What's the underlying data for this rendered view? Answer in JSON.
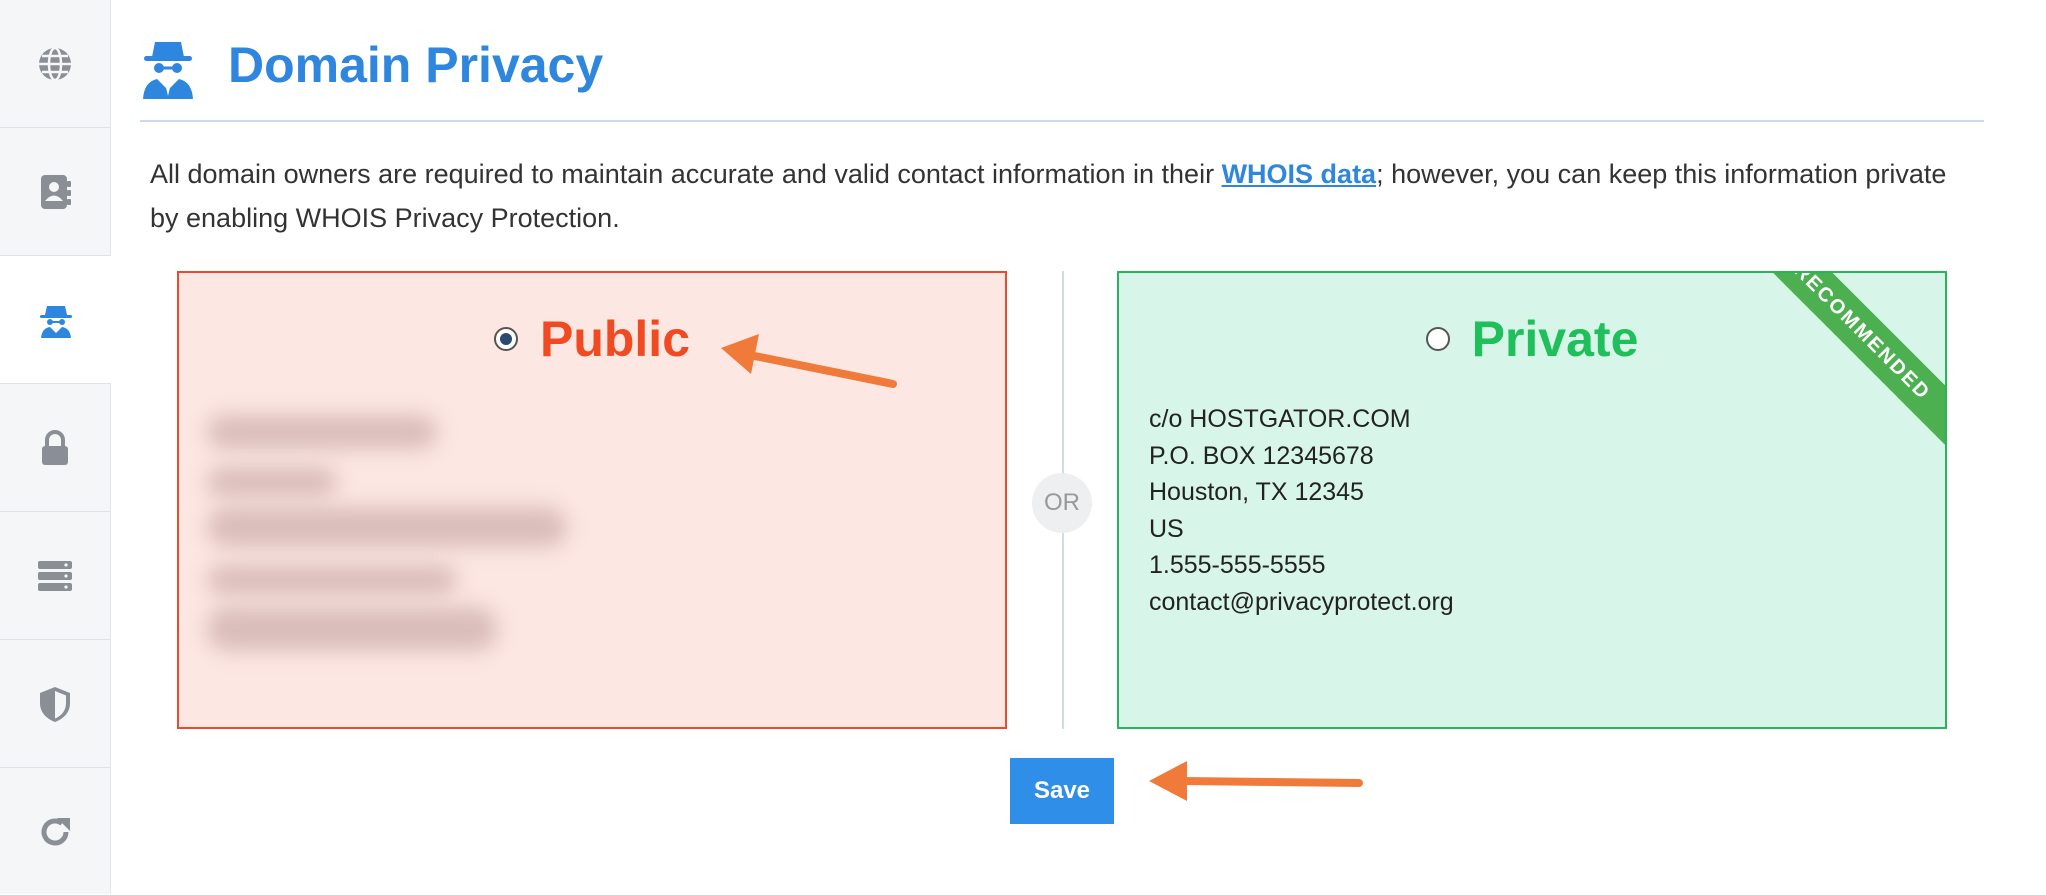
{
  "sidebar": {
    "items": [
      {
        "icon": "globe-icon",
        "active": false
      },
      {
        "icon": "contact-book-icon",
        "active": false
      },
      {
        "icon": "incognito-spy-icon",
        "active": true
      },
      {
        "icon": "lock-icon",
        "active": false
      },
      {
        "icon": "server-icon",
        "active": false
      },
      {
        "icon": "shield-icon",
        "active": false
      },
      {
        "icon": "refresh-icon",
        "active": false
      }
    ]
  },
  "header": {
    "icon": "incognito-spy-icon",
    "title": "Domain Privacy"
  },
  "intro": {
    "before_link": "All domain owners are required to maintain accurate and valid contact information in their ",
    "link_text": "WHOIS data",
    "after_link": "; however, you can keep this information private by enabling WHOIS Privacy Protection."
  },
  "options": {
    "public": {
      "label": "Public",
      "selected": true,
      "contact_obscured": true
    },
    "divider_text": "OR",
    "private": {
      "label": "Private",
      "selected": false,
      "ribbon": "RECOMMENDED",
      "address_lines": [
        "c/o HOSTGATOR.COM",
        "P.O. BOX 12345678",
        "Houston, TX 12345",
        "US",
        "1.555-555-5555",
        "contact@privacyprotect.org"
      ]
    }
  },
  "save_button": {
    "label": "Save"
  },
  "colors": {
    "accent_blue": "#2e86de",
    "public_red": "#f04a23",
    "private_green": "#1fbf5b",
    "annotation_arrow": "#f07a3a"
  }
}
